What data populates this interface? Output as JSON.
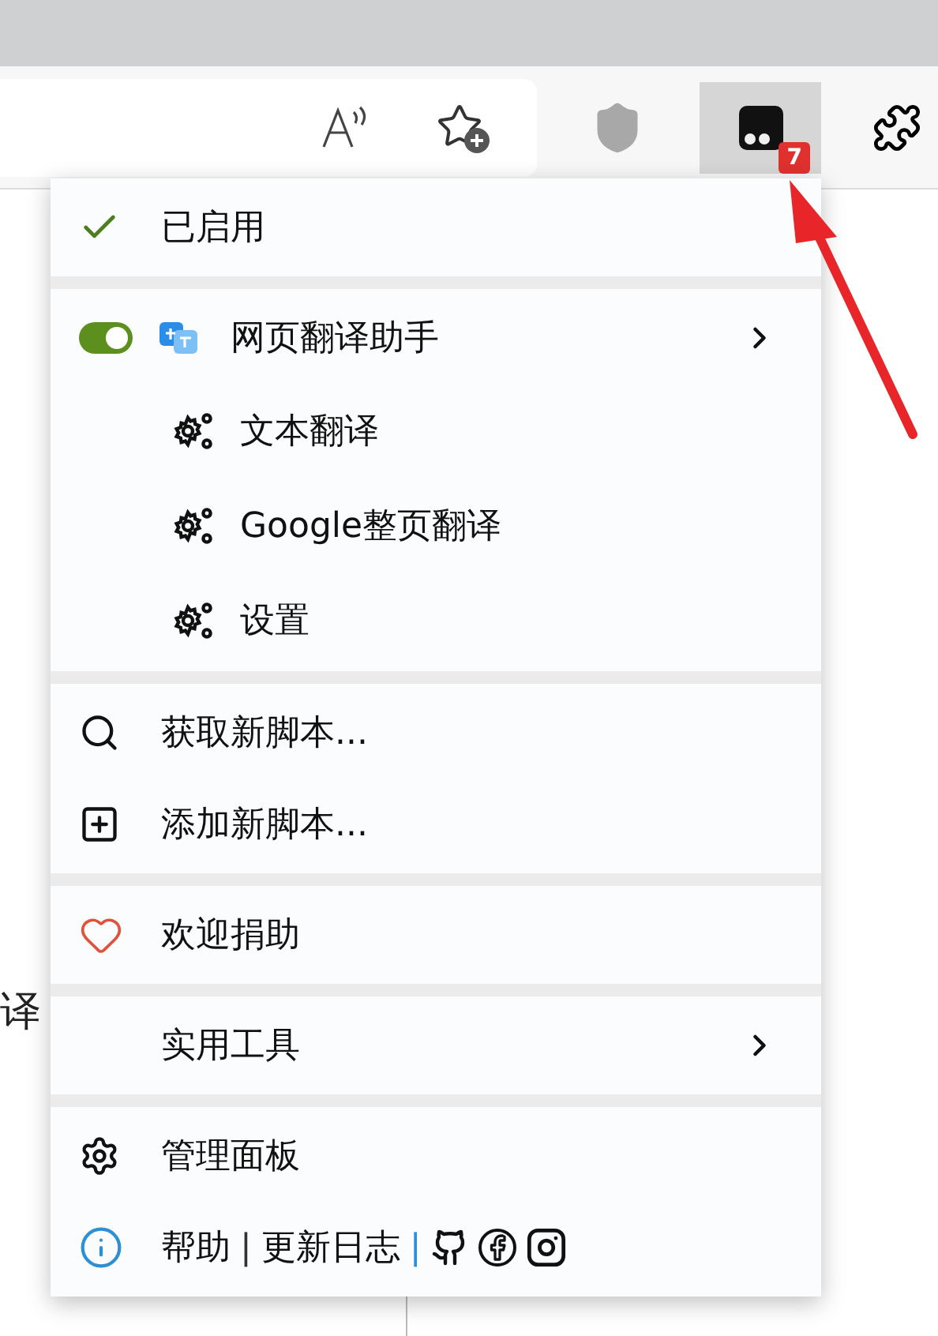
{
  "toolbar": {
    "extension_button": {
      "selected": true,
      "badge": "7"
    }
  },
  "page_text": "译",
  "menu": {
    "sections": [
      {
        "items": [
          {
            "kind": "status",
            "label": "已启用",
            "checked": true
          }
        ]
      },
      {
        "items": [
          {
            "kind": "script",
            "label": "网页翻译助手",
            "on": true,
            "has_submenu": true,
            "children": [
              {
                "label": "文本翻译"
              },
              {
                "label": "Google整页翻译"
              },
              {
                "label": "设置"
              }
            ]
          }
        ]
      },
      {
        "items": [
          {
            "kind": "search",
            "label": "获取新脚本..."
          },
          {
            "kind": "add",
            "label": "添加新脚本..."
          }
        ]
      },
      {
        "items": [
          {
            "kind": "donate",
            "label": "欢迎捐助"
          }
        ]
      },
      {
        "items": [
          {
            "kind": "plain",
            "label": "实用工具",
            "has_submenu": true
          }
        ]
      },
      {
        "items": [
          {
            "kind": "dashboard",
            "label": "管理面板"
          },
          {
            "kind": "links",
            "links": [
              "帮助",
              "更新日志"
            ],
            "separators": [
              "|",
              "|"
            ]
          }
        ]
      }
    ]
  }
}
